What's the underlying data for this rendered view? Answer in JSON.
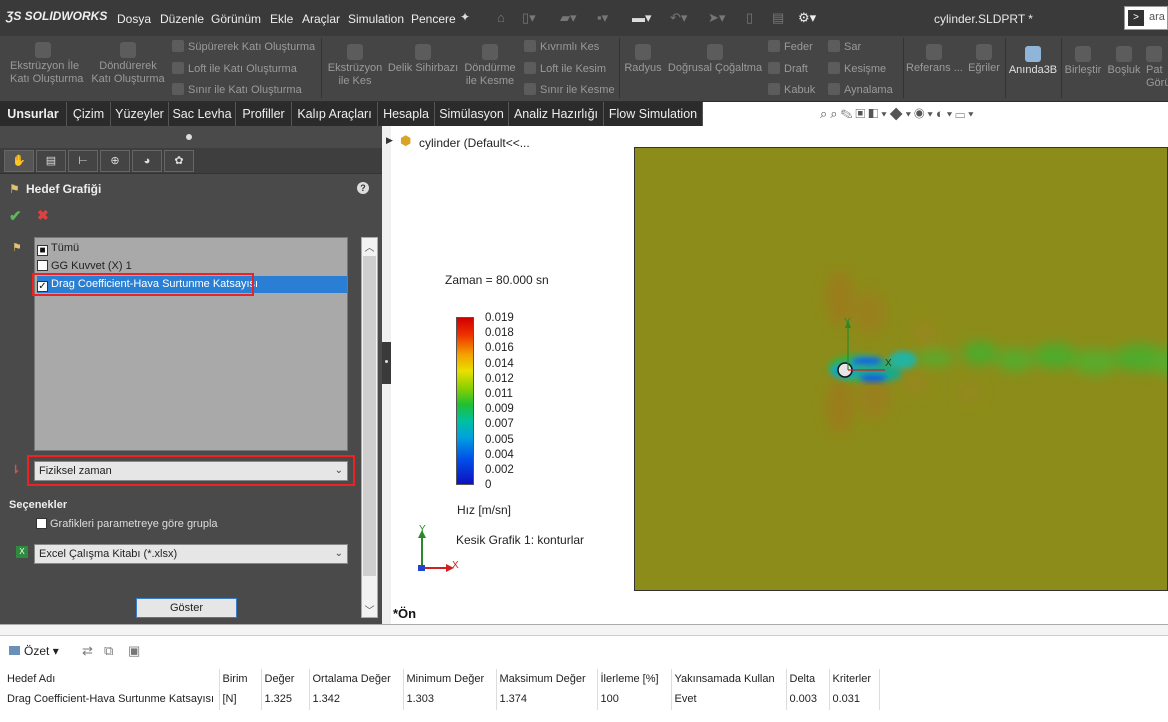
{
  "app": {
    "brand": "SOLIDWORKS",
    "file_name": "cylinder.SLDPRT *",
    "search_text": "ara"
  },
  "menu": [
    "Dosya",
    "Düzenle",
    "Görünüm",
    "Ekle",
    "Araçlar",
    "Simulation",
    "Pencere"
  ],
  "ribbon": {
    "extrude_boss": "Ekstrüzyon İle\nKatı Oluşturma",
    "revolve_boss": "Döndürerek\nKatı Oluşturma",
    "swept_boss": "Süpürerek Katı Oluşturma",
    "loft_boss": "Loft ile Katı Oluşturma",
    "boundary_boss": "Sınır ile Katı Oluşturma",
    "extrude_cut": "Ekstrüzyon\nile Kes",
    "hole_wizard": "Delik Sihirbazı",
    "revolve_cut": "Döndürme\nile Kesme",
    "swept_cut": "Kıvrımlı Kes",
    "loft_cut": "Loft ile Kesim",
    "boundary_cut": "Sınır ile Kesme",
    "fillet": "Radyus",
    "linear_pattern": "Doğrusal Çoğaltma",
    "rib": "Feder",
    "draft": "Draft",
    "shell": "Kabuk",
    "wrap": "Sar",
    "intersect": "Kesişme",
    "mirror": "Aynalama",
    "reference": "Referans ...",
    "curves": "Eğriler",
    "instant3d": "Anında3B",
    "combine": "Birleştir",
    "cavity": "Boşluk",
    "more": "Pat\nGörü"
  },
  "tabs": [
    "Unsurlar",
    "Çizim",
    "Yüzeyler",
    "Sac Levha",
    "Profiller",
    "Kalıp Araçları",
    "Hesapla",
    "Simülasyon",
    "Analiz Hazırlığı",
    "Flow Simulation"
  ],
  "property_manager": {
    "title": "Hedef Grafiği",
    "help": "?",
    "goals": [
      {
        "label": "Tümü",
        "checked": false
      },
      {
        "label": "GG Kuvvet (X) 1",
        "checked": false
      },
      {
        "label": "Drag Coefficient-Hava Surtunme Katsayısı",
        "checked": true
      }
    ],
    "x_axis_value": "Fiziksel zaman",
    "options_title": "Seçenekler",
    "group_option": "Grafikleri parametreye göre grupla",
    "export_format": "Excel Çalışma Kitabı (*.xlsx)",
    "show_button": "Göster"
  },
  "graphics": {
    "tree_item": "cylinder  (Default<<...",
    "time_label": "Zaman = 80.000 sn",
    "colorbar_ticks": [
      "0.019",
      "0.018",
      "0.016",
      "0.014",
      "0.012",
      "0.011",
      "0.009",
      "0.007",
      "0.005",
      "0.004",
      "0.002",
      "0"
    ],
    "unit": "Hız [m/sn]",
    "cut_plot_label": "Kesik Grafik 1: konturlar",
    "view_name": "*Ön",
    "axis_y": "Y",
    "axis_x": "X"
  },
  "results": {
    "summary_button": "Özet",
    "headers": [
      "Hedef Adı",
      "Birim",
      "Değer",
      "Ortalama Değer",
      "Minimum Değer",
      "Maksimum Değer",
      "İlerleme [%]",
      "Yakınsamada Kullan",
      "Delta",
      "Kriterler"
    ],
    "rows": [
      [
        "Drag Coefficient-Hava Surtunme Katsayısı",
        "[N]",
        "1.325",
        "1.342",
        "1.303",
        "1.374",
        "100",
        "Evet",
        "0.003",
        "0.031"
      ]
    ]
  },
  "colors": {
    "field_background": "#8c8c1a",
    "selection": "#2a7fd4",
    "highlight_box": "#e22222"
  }
}
